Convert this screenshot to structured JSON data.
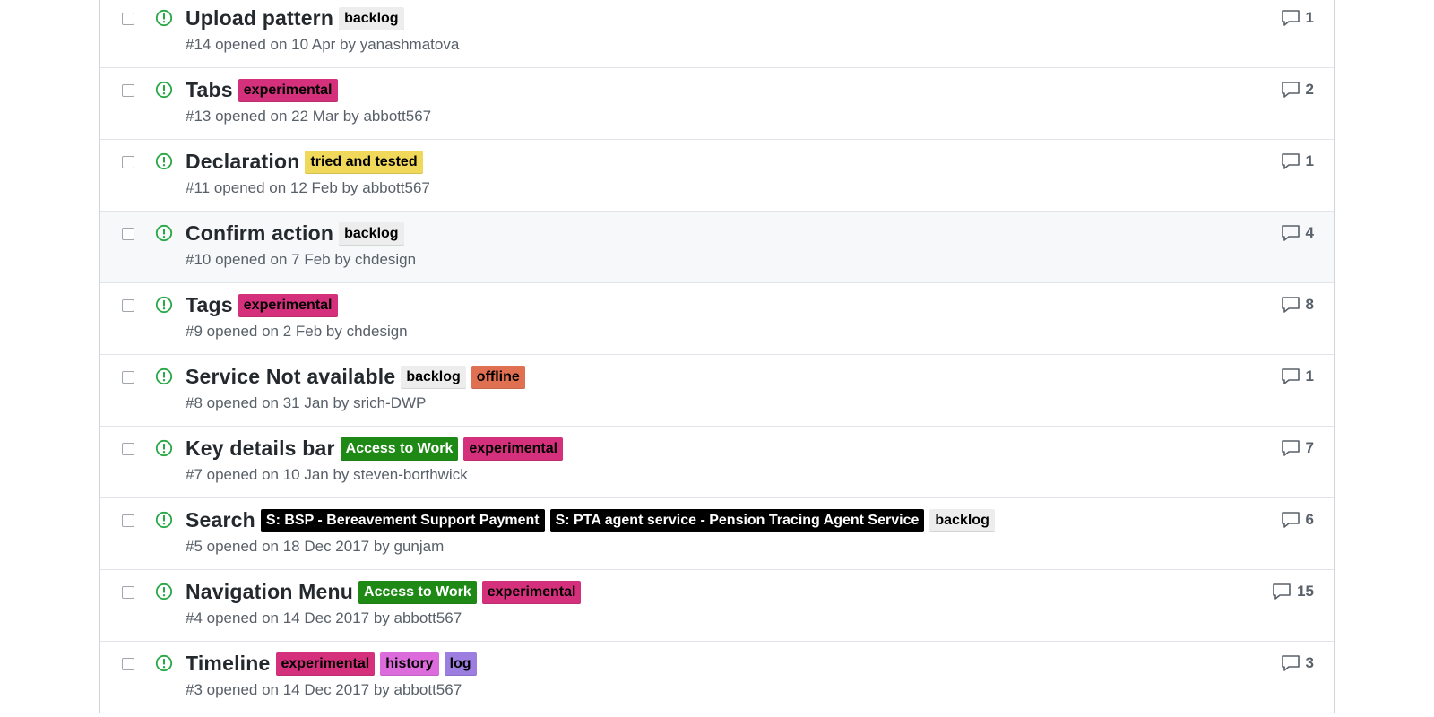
{
  "colors": {
    "open_icon": "#28a745",
    "labels": {
      "backlog": {
        "bg": "#ededed",
        "fg": "#000000"
      },
      "experimental": {
        "bg": "#d4307c",
        "fg": "#000000"
      },
      "tried and tested": {
        "bg": "#f0d85a",
        "fg": "#000000"
      },
      "offline": {
        "bg": "#e07052",
        "fg": "#000000"
      },
      "Access to Work": {
        "bg": "#1e8a15",
        "fg": "#ffffff"
      },
      "S: BSP - Bereavement Support Payment": {
        "bg": "#000000",
        "fg": "#ffffff"
      },
      "S: PTA agent service - Pension Tracing Agent Service": {
        "bg": "#000000",
        "fg": "#ffffff"
      },
      "history": {
        "bg": "#dc6bdc",
        "fg": "#000000"
      },
      "log": {
        "bg": "#9b7ee0",
        "fg": "#000000"
      }
    }
  },
  "issues": [
    {
      "title": "Upload pattern",
      "labels": [
        "backlog"
      ],
      "meta": "#14 opened on 10 Apr by yanashmatova",
      "comments": "1",
      "highlight": false
    },
    {
      "title": "Tabs",
      "labels": [
        "experimental"
      ],
      "meta": "#13 opened on 22 Mar by abbott567",
      "comments": "2",
      "highlight": false
    },
    {
      "title": "Declaration",
      "labels": [
        "tried and tested"
      ],
      "meta": "#11 opened on 12 Feb by abbott567",
      "comments": "1",
      "highlight": false
    },
    {
      "title": "Confirm action",
      "labels": [
        "backlog"
      ],
      "meta": "#10 opened on 7 Feb by chdesign",
      "comments": "4",
      "highlight": true
    },
    {
      "title": "Tags",
      "labels": [
        "experimental"
      ],
      "meta": "#9 opened on 2 Feb by chdesign",
      "comments": "8",
      "highlight": false
    },
    {
      "title": "Service Not available",
      "labels": [
        "backlog",
        "offline"
      ],
      "meta": "#8 opened on 31 Jan by srich-DWP",
      "comments": "1",
      "highlight": false
    },
    {
      "title": "Key details bar",
      "labels": [
        "Access to Work",
        "experimental"
      ],
      "meta": "#7 opened on 10 Jan by steven-borthwick",
      "comments": "7",
      "highlight": false
    },
    {
      "title": "Search",
      "labels": [
        "S: BSP - Bereavement Support Payment",
        "S: PTA agent service - Pension Tracing Agent Service",
        "backlog"
      ],
      "meta": "#5 opened on 18 Dec 2017 by gunjam",
      "comments": "6",
      "highlight": false
    },
    {
      "title": "Navigation Menu",
      "labels": [
        "Access to Work",
        "experimental"
      ],
      "meta": "#4 opened on 14 Dec 2017 by abbott567",
      "comments": "15",
      "highlight": false
    },
    {
      "title": "Timeline",
      "labels": [
        "experimental",
        "history",
        "log"
      ],
      "meta": "#3 opened on 14 Dec 2017 by abbott567",
      "comments": "3",
      "highlight": false
    }
  ]
}
